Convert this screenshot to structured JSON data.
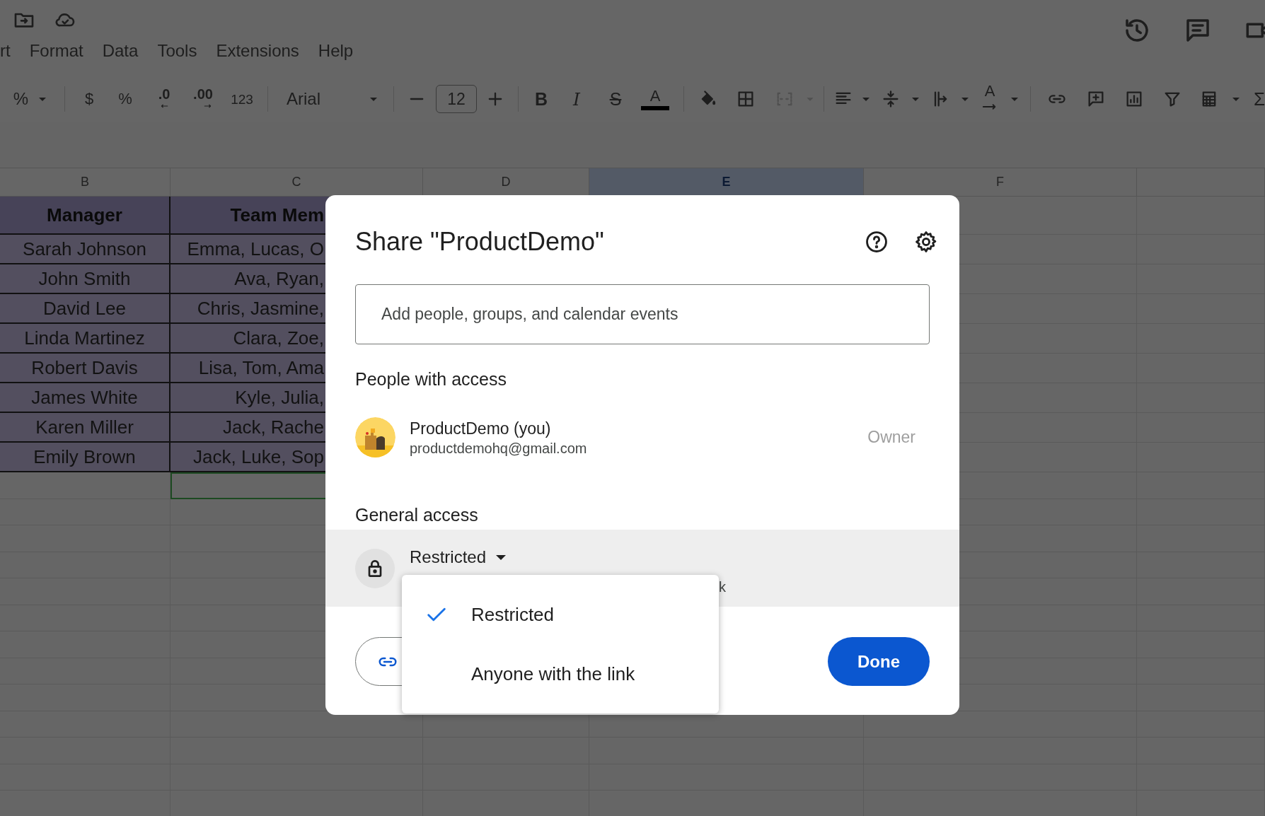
{
  "menu_bar": [
    "rt",
    "Format",
    "Data",
    "Tools",
    "Extensions",
    "Help"
  ],
  "toolbar": {
    "zoom": "%",
    "currency": "$",
    "percent": "%",
    "decrease_decimal": ".0",
    "increase_decimal": ".00",
    "number_formats": "123",
    "font": "Arial",
    "font_size": "12",
    "bold": "B",
    "italic": "I",
    "strikethrough": "S",
    "text_color": "A",
    "text_rotation": "A",
    "functions": "Σ"
  },
  "sheet": {
    "columns": [
      {
        "label": "B",
        "selected": false
      },
      {
        "label": "C",
        "selected": false
      },
      {
        "label": "D",
        "selected": false
      },
      {
        "label": "E",
        "selected": true
      },
      {
        "label": "F",
        "selected": false
      }
    ],
    "header": [
      "Manager",
      "Team Mem"
    ],
    "rows": [
      [
        "Sarah Johnson",
        "Emma, Lucas, O"
      ],
      [
        "John Smith",
        "Ava, Ryan,"
      ],
      [
        "David Lee",
        "Chris, Jasmine,"
      ],
      [
        "Linda Martinez",
        "Clara, Zoe,"
      ],
      [
        "Robert Davis",
        "Lisa, Tom, Ama"
      ],
      [
        "James White",
        "Kyle, Julia,"
      ],
      [
        "Karen Miller",
        "Jack, Rache"
      ],
      [
        "Emily Brown",
        "Jack, Luke, Sop"
      ]
    ],
    "active_cell_visible": true
  },
  "dialog": {
    "title": "Share \"ProductDemo\"",
    "input": {
      "placeholder": "Add people, groups, and calendar events"
    },
    "people_heading": "People with access",
    "people": [
      {
        "name": "ProductDemo (you)",
        "email": "productdemohq@gmail.com",
        "role": "Owner"
      }
    ],
    "general_heading": "General access",
    "access": {
      "value": "Restricted",
      "description_visible": "k"
    },
    "access_menu": [
      {
        "label": "Restricted",
        "selected": true
      },
      {
        "label": "Anyone with the link",
        "selected": false
      }
    ],
    "done_button": "Done"
  }
}
